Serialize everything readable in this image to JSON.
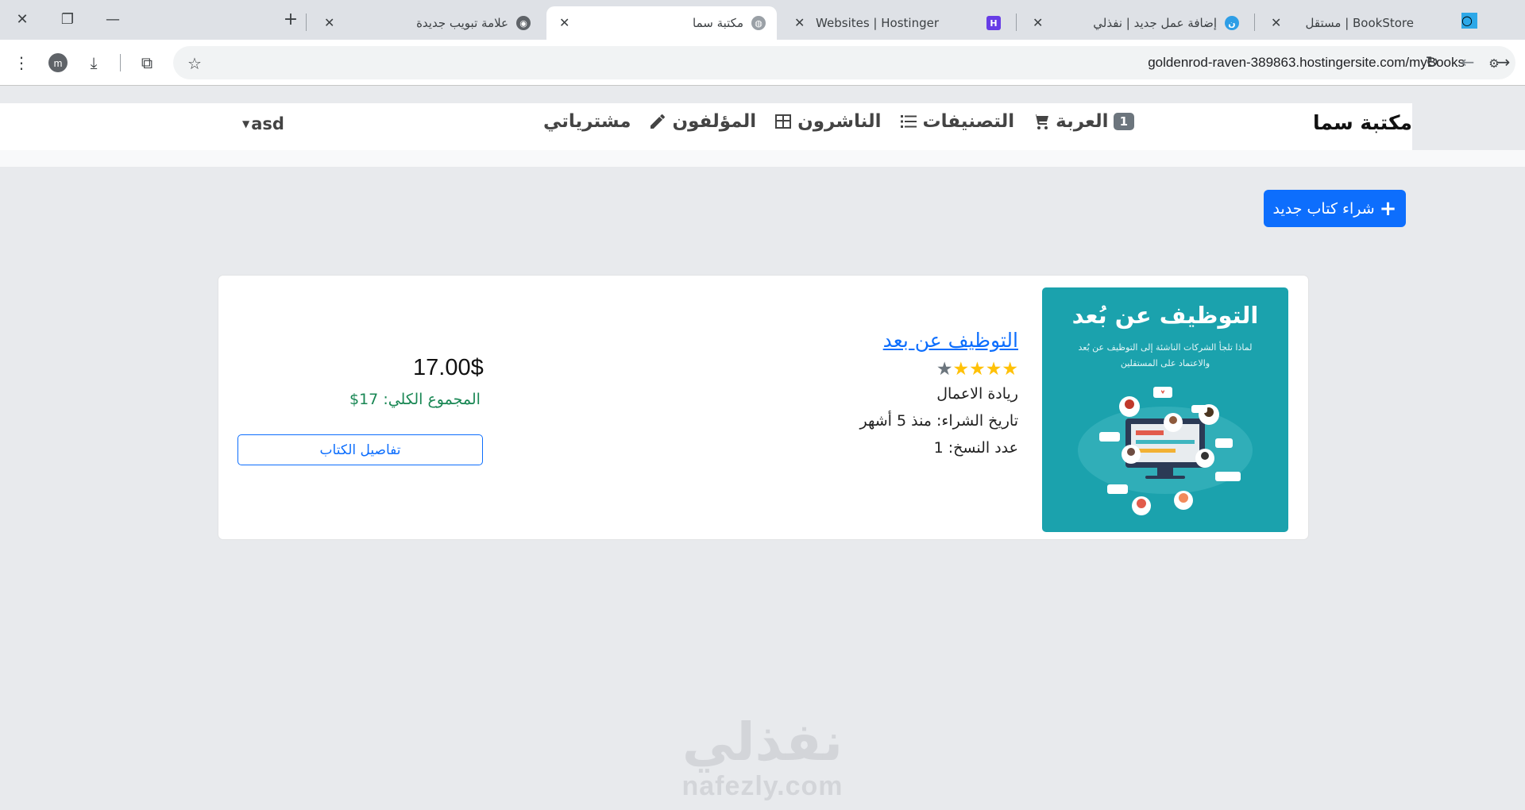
{
  "browser": {
    "tabs": [
      {
        "title": "مستقل | BookStore",
        "icon": "mostaql-icon",
        "active": false
      },
      {
        "title": "إضافة عمل جديد | نفذلي",
        "icon": "nafezly-icon",
        "active": false
      },
      {
        "title": "Websites | Hostinger",
        "icon": "hostinger-icon",
        "active": false
      },
      {
        "title": "مكتبة سما",
        "icon": "globe-icon",
        "active": true
      },
      {
        "title": "علامة تبويب جديدة",
        "icon": "chrome-icon",
        "active": false
      }
    ],
    "url": "goldenrod-raven-389863.hostingersite.com/myBooks",
    "profile_initial": "m"
  },
  "navbar": {
    "brand": "مكتبة سما",
    "cart_count": "1",
    "cart_label": "العربة",
    "categories_label": "التصنيفات",
    "publishers_label": "الناشرون",
    "authors_label": "المؤلفون",
    "purchases_label": "مشترياتي",
    "user_name": "asd"
  },
  "main": {
    "buy_new_label": "شراء كتاب جديد",
    "book": {
      "cover_title": "التوظيف عن بُعد",
      "cover_subtitle": "لماذا تلجأ الشركات الناشئة إلى التوظيف عن بُعد والاعتماد على المستقلين",
      "title": "التوظيف عن بعد",
      "rating": 4,
      "rating_max": 5,
      "category": "ريادة الاعمال",
      "purchase_date": "تاريخ الشراء: منذ 5 أشهر",
      "copies": "عدد النسخ: 1",
      "price": "17.00$",
      "total": "المجموع الكلي: 17$",
      "details_label": "تفاصيل الكتاب"
    }
  },
  "watermark": {
    "arabic": "نفذلي",
    "latin": "nafezly.com"
  },
  "colors": {
    "primary": "#0d6efd",
    "success": "#198754",
    "star": "#ffc107",
    "cover": "#1ba2ad"
  }
}
